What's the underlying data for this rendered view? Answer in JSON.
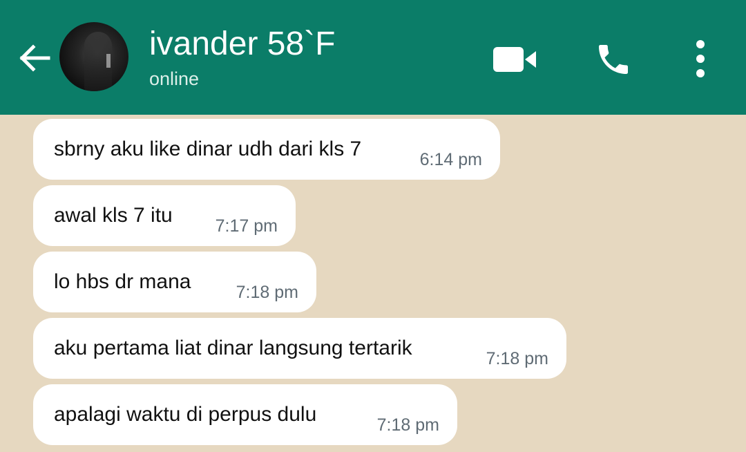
{
  "header": {
    "contact_name": "ivander 58`F",
    "status": "online",
    "back_icon": "arrow-left-icon",
    "icons": [
      "video-camera-icon",
      "phone-icon",
      "more-vertical-icon"
    ],
    "colors": {
      "header_bg": "#0b7d68",
      "chat_bg": "#e6d8c0",
      "bubble_bg": "#ffffff",
      "time_color": "#5f6b74"
    }
  },
  "messages": [
    {
      "text": "sbrny aku like dinar udh dari kls 7",
      "time": "6:14 pm"
    },
    {
      "text": "awal kls 7 itu",
      "time": "7:17 pm"
    },
    {
      "text": "lo hbs dr mana",
      "time": "7:18 pm"
    },
    {
      "text": "aku pertama liat dinar langsung tertarik",
      "time": "7:18 pm"
    },
    {
      "text": "apalagi waktu di perpus dulu",
      "time": "7:18 pm"
    }
  ]
}
